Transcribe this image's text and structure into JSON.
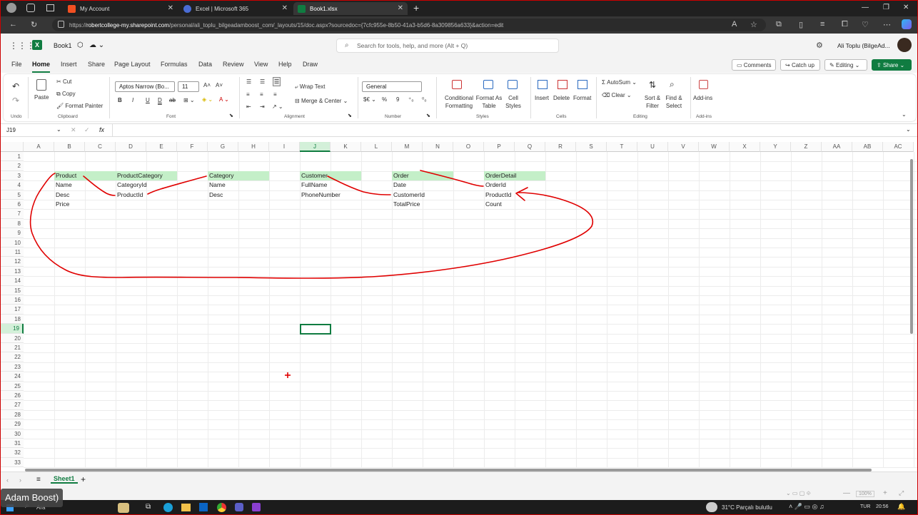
{
  "browser": {
    "tabs": [
      {
        "title": "My Account",
        "icon_color": "#f25022"
      },
      {
        "title": "Excel | Microsoft 365",
        "icon_color": "#4a6cd4"
      },
      {
        "title": "Book1.xlsx",
        "icon_color": "#107c41"
      }
    ],
    "url_prefix": "https://",
    "url_domain": "robertcollege-my.sharepoint.com",
    "url_rest": "/personal/ali_toplu_bilgeadamboost_com/_layouts/15/doc.aspx?sourcedoc={7cfc955e-8b50-41a3-b5d6-8a309856a633}&action=edit"
  },
  "excel": {
    "doc_title": "Book1",
    "search_placeholder": "Search for tools, help, and more (Alt + Q)",
    "user_name": "Ali Toplu (BilgeAd...",
    "menu": [
      "File",
      "Home",
      "Insert",
      "Share",
      "Page Layout",
      "Formulas",
      "Data",
      "Review",
      "View",
      "Help",
      "Draw"
    ],
    "menu_selected": "Home",
    "right_buttons": {
      "comments": "Comments",
      "catchup": "Catch up",
      "editing": "Editing",
      "share": "Share"
    },
    "ribbon": {
      "undo_group": "Undo",
      "paste": "Paste",
      "cut": "Cut",
      "copy": "Copy",
      "format_painter": "Format Painter",
      "clipboard_group": "Clipboard",
      "font_name": "Aptos Narrow (Bo...",
      "font_size": "11",
      "font_group": "Font",
      "wrap_text": "Wrap Text",
      "merge_center": "Merge & Center",
      "alignment_group": "Alignment",
      "number_format": "General",
      "number_group": "Number",
      "cond_format": "Conditional Formatting",
      "format_table": "Format As Table",
      "cell_styles": "Cell Styles",
      "styles_group": "Styles",
      "insert": "Insert",
      "delete": "Delete",
      "format": "Format",
      "cells_group": "Cells",
      "autosum": "AutoSum",
      "clear": "Clear",
      "sort_filter": "Sort & Filter",
      "find_select": "Find & Select",
      "editing_group": "Editing",
      "addins": "Add-ins",
      "addins_group": "Add-ins"
    },
    "name_box": "J19",
    "columns": [
      "A",
      "B",
      "C",
      "D",
      "E",
      "F",
      "G",
      "H",
      "I",
      "J",
      "K",
      "L",
      "M",
      "N",
      "O",
      "P",
      "Q",
      "R",
      "S",
      "T",
      "U",
      "V",
      "W",
      "X",
      "Y",
      "Z",
      "AA",
      "AB",
      "AC"
    ],
    "rows": [
      "1",
      "2",
      "3",
      "4",
      "5",
      "6",
      "7",
      "8",
      "9",
      "10",
      "11",
      "12",
      "13",
      "14",
      "15",
      "16",
      "17",
      "18",
      "19",
      "20",
      "21",
      "22",
      "23",
      "24",
      "25",
      "26",
      "27",
      "28",
      "29",
      "30",
      "31",
      "32",
      "33"
    ],
    "selected_cell": {
      "col": "J",
      "row": "19"
    },
    "cells": [
      {
        "col": "B",
        "row": "3",
        "text": "Product",
        "header": true
      },
      {
        "col": "B",
        "row": "4",
        "text": "Name"
      },
      {
        "col": "B",
        "row": "5",
        "text": "Desc"
      },
      {
        "col": "B",
        "row": "6",
        "text": "Price"
      },
      {
        "col": "D",
        "row": "3",
        "text": "ProductCategory",
        "header": true
      },
      {
        "col": "D",
        "row": "4",
        "text": "CategoryId"
      },
      {
        "col": "D",
        "row": "5",
        "text": "ProductId"
      },
      {
        "col": "G",
        "row": "3",
        "text": "Category",
        "header": true
      },
      {
        "col": "G",
        "row": "4",
        "text": "Name"
      },
      {
        "col": "G",
        "row": "5",
        "text": "Desc"
      },
      {
        "col": "J",
        "row": "3",
        "text": "Customer",
        "header": true
      },
      {
        "col": "J",
        "row": "4",
        "text": "FullName"
      },
      {
        "col": "J",
        "row": "5",
        "text": "PhoneNumber"
      },
      {
        "col": "M",
        "row": "3",
        "text": "Order",
        "header": true
      },
      {
        "col": "M",
        "row": "4",
        "text": "Date"
      },
      {
        "col": "M",
        "row": "5",
        "text": "CustomerId"
      },
      {
        "col": "M",
        "row": "6",
        "text": "TotalPrice"
      },
      {
        "col": "P",
        "row": "3",
        "text": "OrderDetail",
        "header": true
      },
      {
        "col": "P",
        "row": "4",
        "text": "OrderId"
      },
      {
        "col": "P",
        "row": "5",
        "text": "ProductId"
      },
      {
        "col": "P",
        "row": "6",
        "text": "Count"
      }
    ],
    "sheet_tab": "Sheet1",
    "zoom": "100%"
  },
  "taskbar": {
    "search": "Ara",
    "weather": "31°C  Parçalı bulutlu",
    "lang": "TUR",
    "time": "20:56"
  },
  "overlay_text": "Adam Boost)",
  "colors": {
    "excel_green": "#107c41",
    "header_fill": "#c4efc8",
    "ink": "#e00000"
  }
}
